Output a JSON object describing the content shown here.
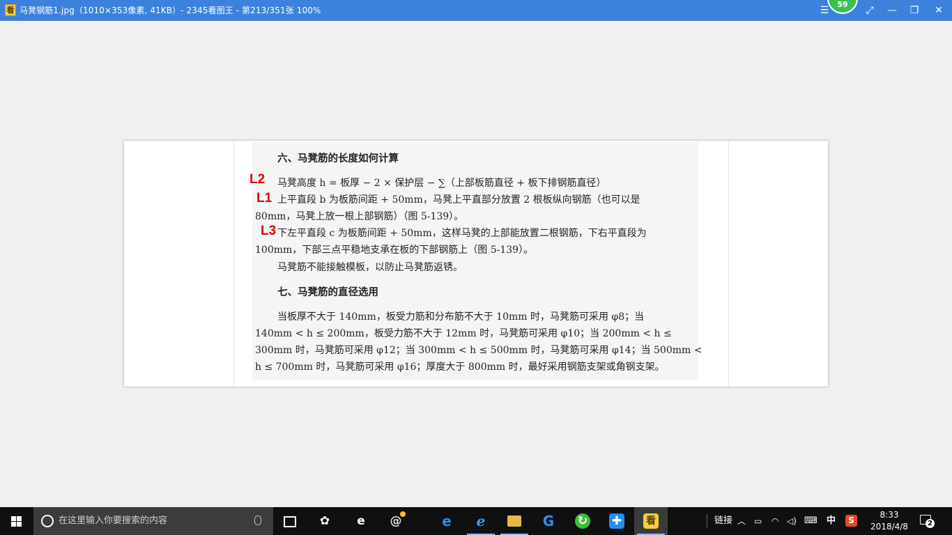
{
  "window": {
    "app_icon_glyph": "看",
    "title": "马凳钢筋1.jpg（1010×353像素, 41KB）- 2345看图王 - 第213/351张 100%",
    "badge_number": "59",
    "buttons": {
      "menu": "☰",
      "fullscreen": "⤢",
      "minimize": "—",
      "restore": "❐",
      "close": "✕"
    }
  },
  "document": {
    "heading6": "六、马凳筋的长度如何计算",
    "line_l2": "马凳高度 h = 板厚 − 2 × 保护层 − ∑（上部板筋直径 + 板下排钢筋直径）",
    "line_l1a": "上平直段 b 为板筋间距 + 50mm，马凳上平直部分放置 2 根板纵向钢筋（也可以是",
    "line_l1b": "80mm，马凳上放一根上部钢筋）（图 5-139）。",
    "line_l3a": "下左平直段 c 为板筋间距 + 50mm，这样马凳的上部能放置二根钢筋，下右平直段为",
    "line_l3b": "100mm，下部三点平稳地支承在板的下部钢筋上（图 5-139）。",
    "line_rust": "马凳筋不能接触模板，以防止马凳筋返锈。",
    "heading7": "七、马凳筋的直径选用",
    "para7_1": "当板厚不大于 140mm，板受力筋和分布筋不大于 10mm 时，马凳筋可采用 φ8；当",
    "para7_2": "140mm < h ≤ 200mm，板受力筋不大于 12mm 时，马凳筋可采用 φ10；当 200mm < h ≤",
    "para7_3": "300mm 时，马凳筋可采用 φ12；当 300mm < h ≤ 500mm 时，马凳筋可采用 φ14；当 500mm <",
    "para7_4": "h ≤ 700mm 时，马凳筋可采用 φ16；厚度大于 800mm 时，最好采用钢筋支架或角钢支架。",
    "markers": {
      "l2": "L2",
      "l1": "L1",
      "l3": "L3"
    },
    "marker_color": "#e00000"
  },
  "taskbar": {
    "search_placeholder": "在这里输入你要搜索的内容",
    "tray_link": "链接",
    "ime": "中",
    "time": "8:33",
    "date": "2018/4/8",
    "notification_count": "2"
  },
  "colors": {
    "titlebar": "#3c82dc",
    "taskbar": "#101010",
    "search_box": "#3c3c3c",
    "background": "#f0f0f0"
  }
}
